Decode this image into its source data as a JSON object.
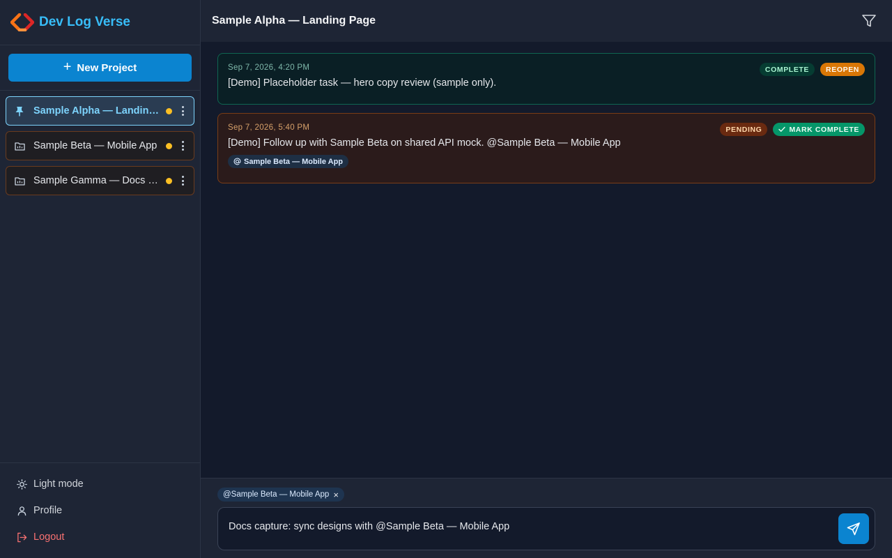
{
  "brand": {
    "name": "Dev Log Verse"
  },
  "sidebar": {
    "new_project_label": "New Project",
    "projects": [
      {
        "label": "Sample Alpha — Landing Page",
        "active": true,
        "icon": "pin-icon"
      },
      {
        "label": "Sample Beta — Mobile App",
        "active": false,
        "icon": "folder-icon"
      },
      {
        "label": "Sample Gamma — Docs Site",
        "active": false,
        "icon": "folder-icon"
      }
    ],
    "footer": {
      "light_mode": "Light mode",
      "profile": "Profile",
      "logout": "Logout"
    }
  },
  "header": {
    "title": "Sample Alpha — Landing Page"
  },
  "entries": [
    {
      "timestamp": "Sep 7, 2026, 4:20 PM",
      "status": "COMPLETE",
      "action": "REOPEN",
      "text": "[Demo] Placeholder task — hero copy review (sample only)."
    },
    {
      "timestamp": "Sep 7, 2026, 5:40 PM",
      "status": "PENDING",
      "action": "MARK COMPLETE",
      "text": "[Demo] Follow up with Sample Beta on shared API mock. @Sample Beta — Mobile App",
      "mention": "Sample Beta — Mobile App"
    }
  ],
  "composer": {
    "tag": "@Sample Beta — Mobile App",
    "value": "Docs capture: sync designs with @Sample Beta — Mobile App"
  },
  "colors": {
    "accent": "#0b84d0",
    "brand": "#38bdf8",
    "complete": "#059669",
    "pending": "#d97706",
    "logout": "#f87171"
  }
}
